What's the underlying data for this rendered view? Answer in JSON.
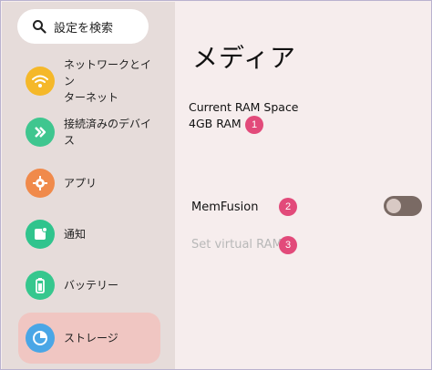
{
  "search": {
    "placeholder": "設定を検索",
    "icon": "search-icon"
  },
  "sidebar": {
    "items": [
      {
        "label_line1": "ネットワークとイン",
        "label_line2": "ターネット",
        "icon": "wifi-icon",
        "color": "#f5b829",
        "active": false
      },
      {
        "label": "接続済みのデバイス",
        "icon": "devices-icon",
        "color": "#3fc68f",
        "active": false
      },
      {
        "label": "アプリ",
        "icon": "apps-icon",
        "color": "#f08a4b",
        "active": false
      },
      {
        "label": "通知",
        "icon": "notifications-icon",
        "color": "#30c48d",
        "active": false
      },
      {
        "label": "バッテリー",
        "icon": "battery-icon",
        "color": "#36c78e",
        "active": false
      },
      {
        "label": "ストレージ",
        "icon": "storage-icon",
        "color": "#4aa6e6",
        "active": true
      }
    ]
  },
  "main": {
    "title": "メディア",
    "ram_title": "Current RAM Space",
    "ram_value": "4GB RAM",
    "memfusion_label": "MemFusion",
    "set_ram_label": "Set virtual RAM",
    "badges": [
      "1",
      "2",
      "3"
    ],
    "toggle_on": false
  }
}
